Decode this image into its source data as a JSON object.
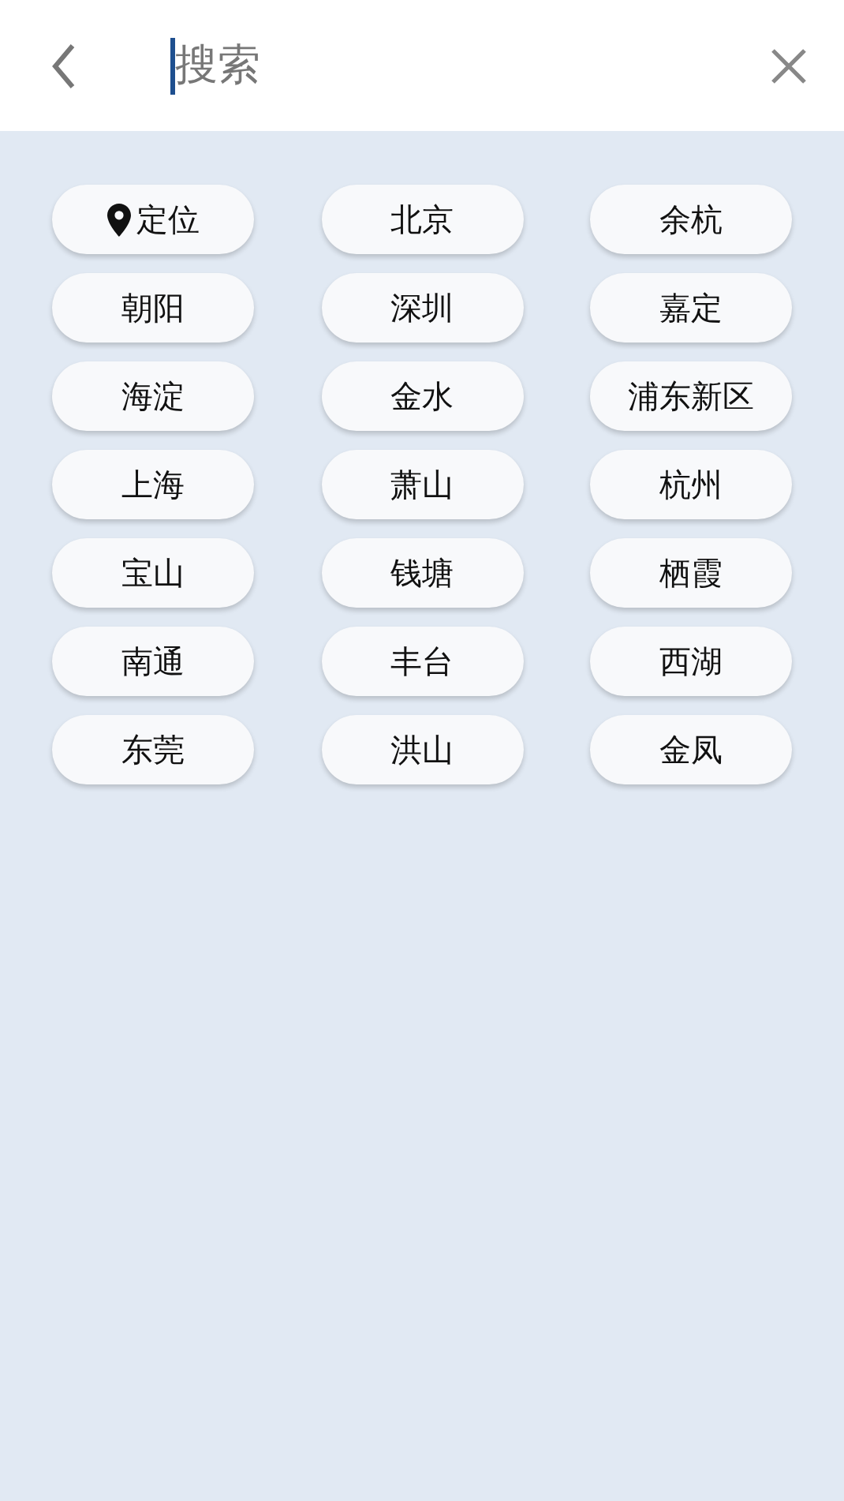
{
  "search": {
    "placeholder": "搜索"
  },
  "cities": [
    {
      "label": "定位",
      "kind": "location"
    },
    {
      "label": "北京",
      "kind": "city"
    },
    {
      "label": "余杭",
      "kind": "city"
    },
    {
      "label": "朝阳",
      "kind": "city"
    },
    {
      "label": "深圳",
      "kind": "city"
    },
    {
      "label": "嘉定",
      "kind": "city"
    },
    {
      "label": "海淀",
      "kind": "city"
    },
    {
      "label": "金水",
      "kind": "city"
    },
    {
      "label": "浦东新区",
      "kind": "city"
    },
    {
      "label": "上海",
      "kind": "city"
    },
    {
      "label": "萧山",
      "kind": "city"
    },
    {
      "label": "杭州",
      "kind": "city"
    },
    {
      "label": "宝山",
      "kind": "city"
    },
    {
      "label": "钱塘",
      "kind": "city"
    },
    {
      "label": "栖霞",
      "kind": "city"
    },
    {
      "label": "南通",
      "kind": "city"
    },
    {
      "label": "丰台",
      "kind": "city"
    },
    {
      "label": "西湖",
      "kind": "city"
    },
    {
      "label": "东莞",
      "kind": "city"
    },
    {
      "label": "洪山",
      "kind": "city"
    },
    {
      "label": "金凤",
      "kind": "city"
    }
  ]
}
